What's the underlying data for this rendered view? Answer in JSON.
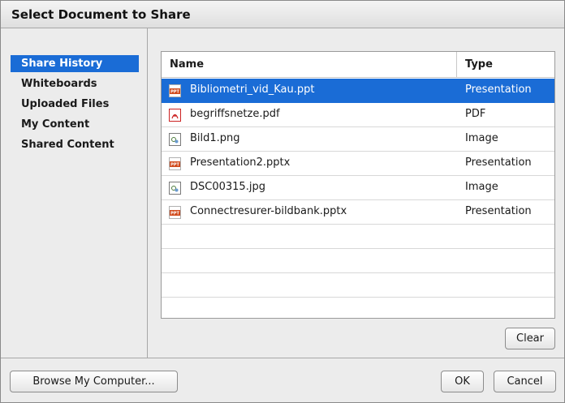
{
  "dialog": {
    "title": "Select Document to Share"
  },
  "sidebar": {
    "items": [
      {
        "label": "Share History",
        "selected": true
      },
      {
        "label": "Whiteboards",
        "selected": false
      },
      {
        "label": "Uploaded Files",
        "selected": false
      },
      {
        "label": "My Content",
        "selected": false
      },
      {
        "label": "Shared Content",
        "selected": false
      }
    ]
  },
  "file_list": {
    "columns": {
      "name": "Name",
      "type": "Type"
    },
    "rows": [
      {
        "name": "Bibliometri_vid_Kau.ppt",
        "type": "Presentation",
        "icon": "presentation-file-icon",
        "selected": true
      },
      {
        "name": "begriffsnetze.pdf",
        "type": "PDF",
        "icon": "pdf-file-icon",
        "selected": false
      },
      {
        "name": "Bild1.png",
        "type": "Image",
        "icon": "image-file-icon",
        "selected": false
      },
      {
        "name": "Presentation2.pptx",
        "type": "Presentation",
        "icon": "presentation-file-icon",
        "selected": false
      },
      {
        "name": "DSC00315.jpg",
        "type": "Image",
        "icon": "image-file-icon",
        "selected": false
      },
      {
        "name": "Connectresurer-bildbank.pptx",
        "type": "Presentation",
        "icon": "presentation-file-icon",
        "selected": false
      }
    ],
    "empty_rows": 4
  },
  "buttons": {
    "clear": "Clear",
    "browse": "Browse My Computer...",
    "ok": "OK",
    "cancel": "Cancel"
  },
  "colors": {
    "selection": "#1a6cd6",
    "dialog_background": "#ececec",
    "presentation_icon": "#d04a1c",
    "pdf_icon": "#cc2222"
  }
}
